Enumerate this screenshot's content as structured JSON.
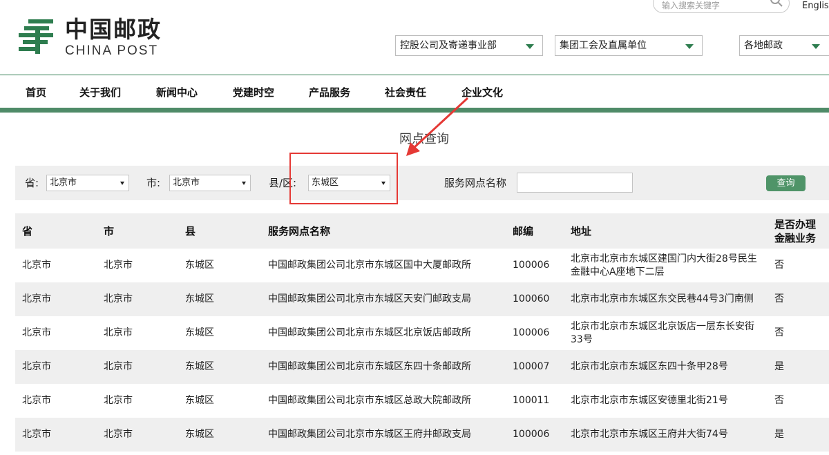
{
  "header": {
    "logo_cn": "中国邮政",
    "logo_en": "CHINA POST",
    "search_placeholder": "输入搜索关键字",
    "language_link": "English",
    "top_selects": [
      "控股公司及寄递事业部",
      "集团工会及直属单位",
      "各地邮政"
    ],
    "brand_color": "#2e7d4f"
  },
  "nav": {
    "items": [
      "首页",
      "关于我们",
      "新闻中心",
      "党建时空",
      "产品服务",
      "社会责任",
      "企业文化"
    ]
  },
  "page": {
    "title": "网点查询"
  },
  "filters": {
    "province_label": "省:",
    "province_value": "北京市",
    "city_label": "市:",
    "city_value": "北京市",
    "county_label": "县/区:",
    "county_value": "东城区",
    "name_label": "服务网点名称",
    "name_value": "",
    "query_button": "查询"
  },
  "table": {
    "headers": [
      "省",
      "市",
      "县",
      "服务网点名称",
      "邮编",
      "地址",
      "是否办理金融业务"
    ],
    "rows": [
      [
        "北京市",
        "北京市",
        "东城区",
        "中国邮政集团公司北京市东城区国中大厦邮政所",
        "100006",
        "北京市北京市东城区建国门内大街28号民生金融中心A座地下二层",
        "否"
      ],
      [
        "北京市",
        "北京市",
        "东城区",
        "中国邮政集团公司北京市东城区天安门邮政支局",
        "100060",
        "北京市北京市东城区东交民巷44号3门南侧",
        "否"
      ],
      [
        "北京市",
        "北京市",
        "东城区",
        "中国邮政集团公司北京市东城区北京饭店邮政所",
        "100006",
        "北京市北京市东城区北京饭店一层东长安街33号",
        "否"
      ],
      [
        "北京市",
        "北京市",
        "东城区",
        "中国邮政集团公司北京市东城区东四十条邮政所",
        "100007",
        "北京市北京市东城区东四十条甲28号",
        "是"
      ],
      [
        "北京市",
        "北京市",
        "东城区",
        "中国邮政集团公司北京市东城区总政大院邮政所",
        "100011",
        "北京市北京市东城区安德里北街21号",
        "否"
      ],
      [
        "北京市",
        "北京市",
        "东城区",
        "中国邮政集团公司北京市东城区王府井邮政支局",
        "100006",
        "北京市北京市东城区王府井大街74号",
        "是"
      ]
    ]
  },
  "annotation": {
    "highlight_color": "#e53935"
  }
}
